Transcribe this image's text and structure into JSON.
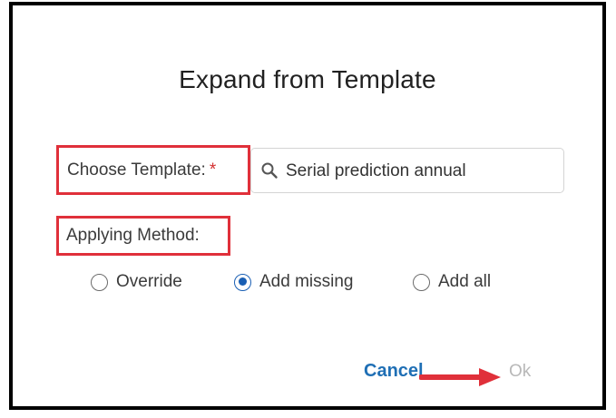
{
  "dialog": {
    "title": "Expand from Template"
  },
  "template_field": {
    "label": "Choose Template:",
    "required_mark": "*",
    "value": "Serial prediction annual",
    "icon": "search-icon"
  },
  "applying_method": {
    "label": "Applying Method:",
    "options": [
      {
        "label": "Override",
        "selected": false
      },
      {
        "label": "Add missing",
        "selected": true
      },
      {
        "label": "Add all",
        "selected": false
      }
    ]
  },
  "footer": {
    "cancel_label": "Cancel",
    "ok_label": "Ok"
  },
  "colors": {
    "highlight_red": "#e0303a",
    "accent_blue": "#1f6fb5",
    "disabled_gray": "#b8b8b8"
  }
}
